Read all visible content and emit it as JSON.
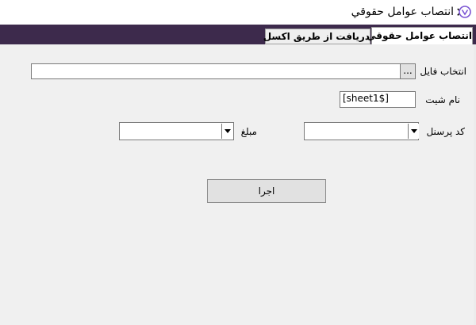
{
  "window": {
    "title": "انتصاب عوامل حقوقي",
    "close_glyph": "✕",
    "icon_name": "app-logo-icon"
  },
  "tabs": [
    {
      "label": "انتصاب عوامل حقوقي",
      "active": true
    },
    {
      "label": "دريافت از طريق اكسل",
      "active": false
    }
  ],
  "form": {
    "file_label": "انتخاب فايل",
    "file_value": "",
    "browse_label": "...",
    "sheet_label": "نام شيت",
    "sheet_value": "[sheet1$]",
    "personnel_label": "كد پرسنل",
    "personnel_value": "",
    "amount_label": "مبلغ",
    "amount_value": "",
    "run_label": "اجرا"
  },
  "colors": {
    "tab_band": "#3d2a4c",
    "icon_accent": "#7b55d3"
  }
}
